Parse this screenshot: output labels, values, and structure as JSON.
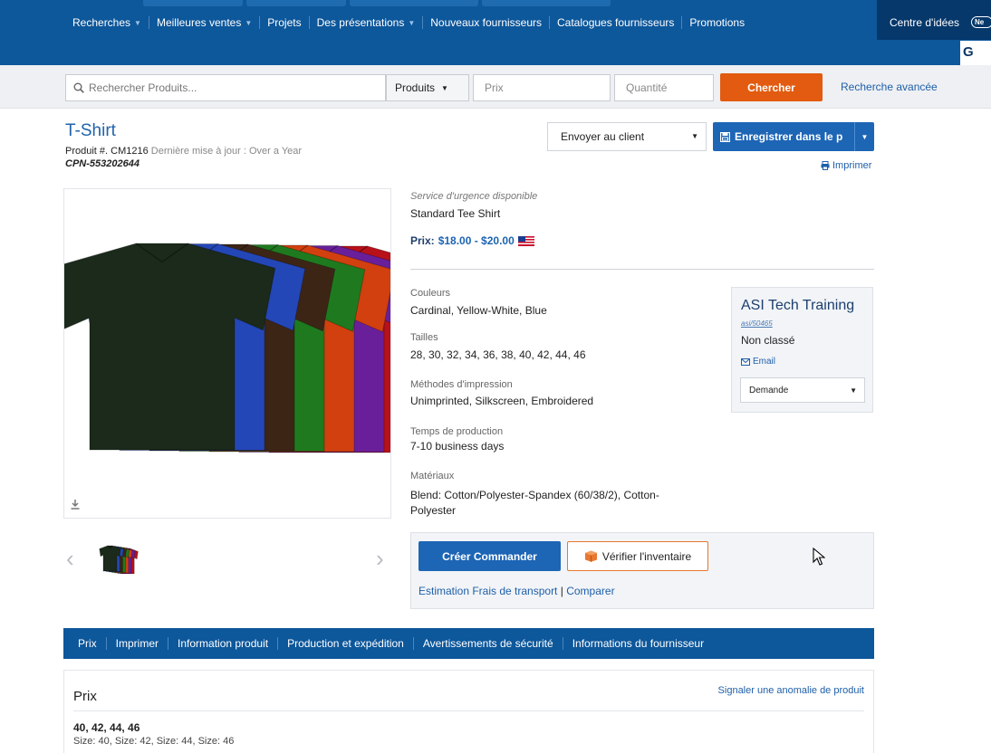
{
  "nav": {
    "items": [
      {
        "label": "Recherches",
        "caret": true
      },
      {
        "label": "Meilleures ventes",
        "caret": true
      },
      {
        "label": "Projets",
        "caret": false
      },
      {
        "label": "Des présentations",
        "caret": true
      },
      {
        "label": "Nouveaux fournisseurs",
        "caret": false
      },
      {
        "label": "Catalogues fournisseurs",
        "caret": false
      },
      {
        "label": "Promotions",
        "caret": false
      }
    ],
    "ideas_label": "Centre d'idées",
    "new_badge": "Ne",
    "gi_logo": "G"
  },
  "search": {
    "placeholder": "Rechercher Produits...",
    "scope_label": "Produits",
    "price_placeholder": "Prix",
    "qty_placeholder": "Quantité",
    "submit_label": "Chercher",
    "advanced_label": "Recherche avancée"
  },
  "product": {
    "title": "T-Shirt",
    "number_label": "Produit #. CM1216",
    "updated_label": "Dernière mise à jour : Over a Year",
    "cpn": "CPN-553202644",
    "send_label": "Envoyer au client",
    "save_label": "Enregistrer dans le p",
    "print_label": "Imprimer",
    "rush_label": "Service d'urgence disponible",
    "subtitle": "Standard Tee Shirt",
    "price_label": "Prix:",
    "price_value": "$18.00 - $20.00",
    "details": [
      {
        "label": "Couleurs",
        "value": "Cardinal, Yellow-White, Blue"
      },
      {
        "label": "Tailles",
        "value": "28, 30, 32, 34, 36, 38, 40, 42, 44, 46"
      },
      {
        "label": "Méthodes d'impression",
        "value": "Unimprinted, Silkscreen, Embroidered"
      },
      {
        "label": "Temps de production",
        "value": "7-10 business days"
      },
      {
        "label": "Matériaux",
        "value": "Blend: Cotton/Polyester-Spandex (60/38/2), Cotton-",
        "value2": "Polyester"
      }
    ],
    "shirt_colors": [
      "#1b2a1a",
      "#2447b8",
      "#3d2516",
      "#1f7a1f",
      "#d2400f",
      "#6a1f9a",
      "#b8111a"
    ]
  },
  "supplier": {
    "name": "ASI Tech Training",
    "id": "asi/50465",
    "rating": "Non classé",
    "email_label": "Email",
    "demand_label": "Demande"
  },
  "order": {
    "create_label": "Créer Commander",
    "inventory_label": "Vérifier l'inventaire",
    "shipping_label": "Estimation Frais de transport",
    "link_sep": "|",
    "compare_label": "Comparer"
  },
  "tabs": [
    "Prix",
    "Imprimer",
    "Information produit",
    "Production et expédition",
    "Avertissements de sécurité",
    "Informations du fournisseur"
  ],
  "price_section": {
    "title": "Prix",
    "report_label": "Signaler une anomalie de produit",
    "sizes_bold": "40, 42, 44, 46",
    "sizes_detail": "Size: 40, Size: 42, Size: 44, Size: 46"
  }
}
